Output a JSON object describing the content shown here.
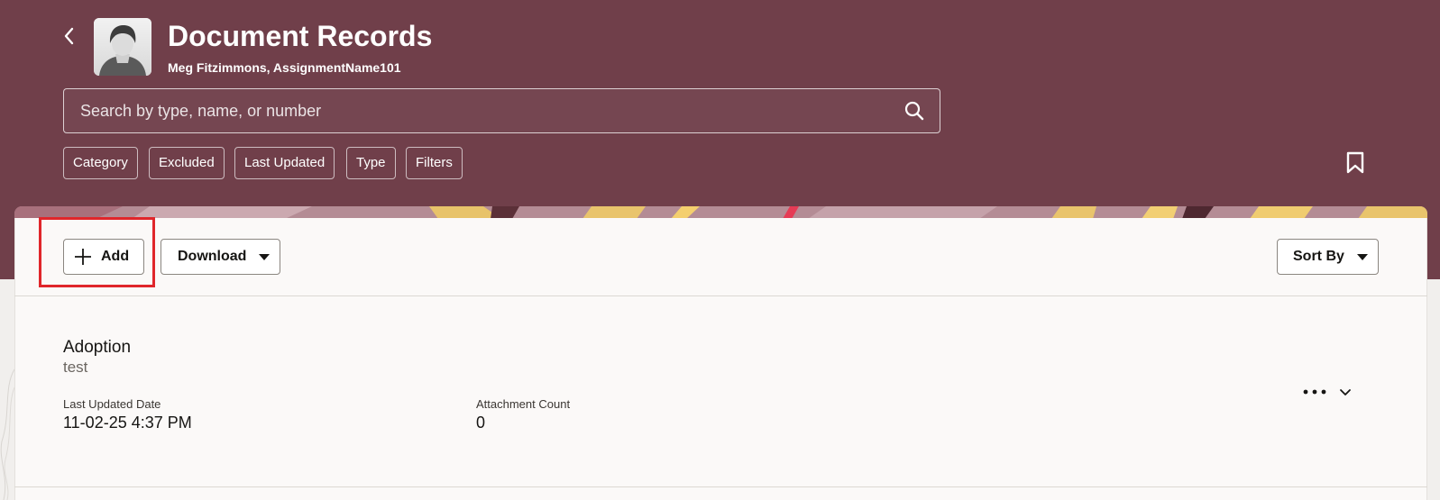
{
  "header": {
    "title": "Document Records",
    "subtitle": "Meg Fitzimmons, AssignmentName101",
    "background_color": "#703f4a",
    "back_icon": "chevron-left-icon",
    "avatar_icon": "person-avatar-icon"
  },
  "search": {
    "placeholder": "Search by type, name, or number",
    "value": "",
    "icon": "search-icon"
  },
  "filters": {
    "chips": [
      "Category",
      "Excluded",
      "Last Updated",
      "Type",
      "Filters"
    ],
    "bookmark_icon": "bookmark-icon"
  },
  "toolbar": {
    "add_label": "Add",
    "download_label": "Download",
    "sort_label": "Sort By",
    "highlight_color": "#e0262b"
  },
  "records": [
    {
      "title": "Adoption",
      "subtitle": "test",
      "fields": [
        {
          "label": "Last Updated Date",
          "value": "11-02-25 4:37 PM"
        },
        {
          "label": "Attachment Count",
          "value": "0"
        }
      ],
      "more_icon": "more-horizontal-icon",
      "expand_icon": "chevron-down-icon"
    }
  ]
}
